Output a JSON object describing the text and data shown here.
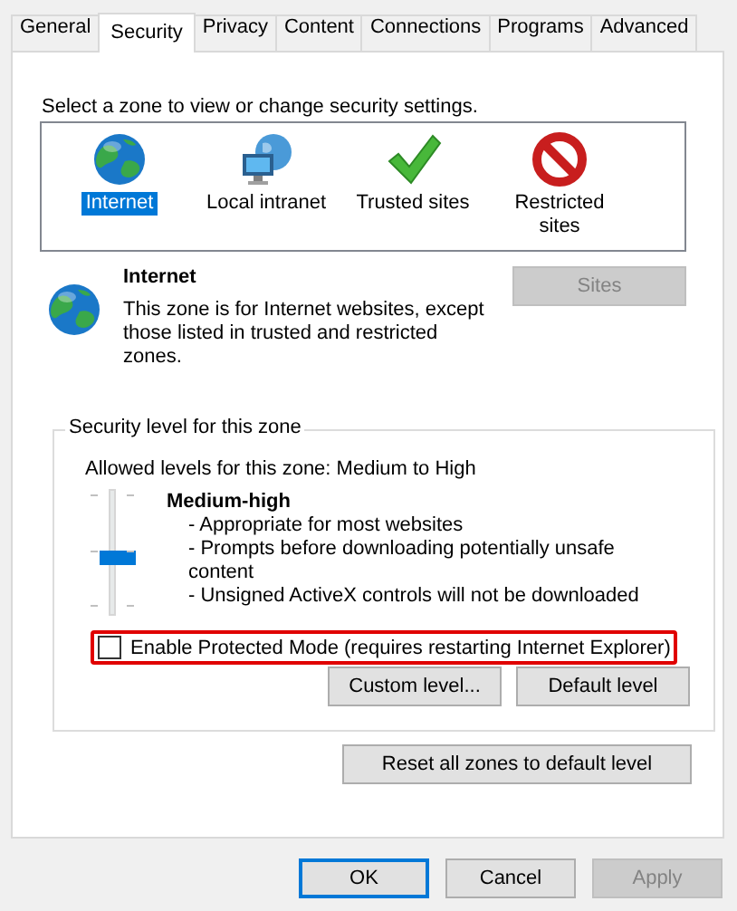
{
  "tabs": [
    {
      "label": "General",
      "selected": false
    },
    {
      "label": "Security",
      "selected": true
    },
    {
      "label": "Privacy",
      "selected": false
    },
    {
      "label": "Content",
      "selected": false
    },
    {
      "label": "Connections",
      "selected": false
    },
    {
      "label": "Programs",
      "selected": false
    },
    {
      "label": "Advanced",
      "selected": false
    }
  ],
  "zones": {
    "prompt": "Select a zone to view or change security settings.",
    "items": [
      {
        "kind": "internet",
        "label": "Internet",
        "selected": true
      },
      {
        "kind": "intranet",
        "label": "Local intranet",
        "selected": false
      },
      {
        "kind": "trusted",
        "label": "Trusted sites",
        "selected": false
      },
      {
        "kind": "restricted",
        "label": "Restricted sites",
        "selected": false
      }
    ]
  },
  "zone_info": {
    "kind": "internet",
    "title": "Internet",
    "description": "This zone is for Internet websites, except those listed in trusted and restricted zones.",
    "sites_button": {
      "label": "Sites",
      "disabled": true
    }
  },
  "security_level": {
    "legend": "Security level for this zone",
    "allowed": "Allowed levels for this zone: Medium to High",
    "slider": {
      "level": 0.5
    },
    "level_name": "Medium-high",
    "details": [
      "- Appropriate for most websites",
      "- Prompts before downloading potentially unsafe content",
      "- Unsigned ActiveX controls will not be downloaded"
    ],
    "protected_mode": {
      "label": "Enable Protected Mode (requires restarting Internet Explorer)",
      "checked": false,
      "highlighted": true
    },
    "buttons": [
      {
        "label": "Custom level..."
      },
      {
        "label": "Default level"
      }
    ]
  },
  "reset_button": {
    "label": "Reset all zones to default level"
  },
  "buttons": [
    {
      "label": "OK",
      "default": true,
      "disabled": false
    },
    {
      "label": "Cancel",
      "default": false,
      "disabled": false
    },
    {
      "label": "Apply",
      "default": false,
      "disabled": true
    }
  ]
}
